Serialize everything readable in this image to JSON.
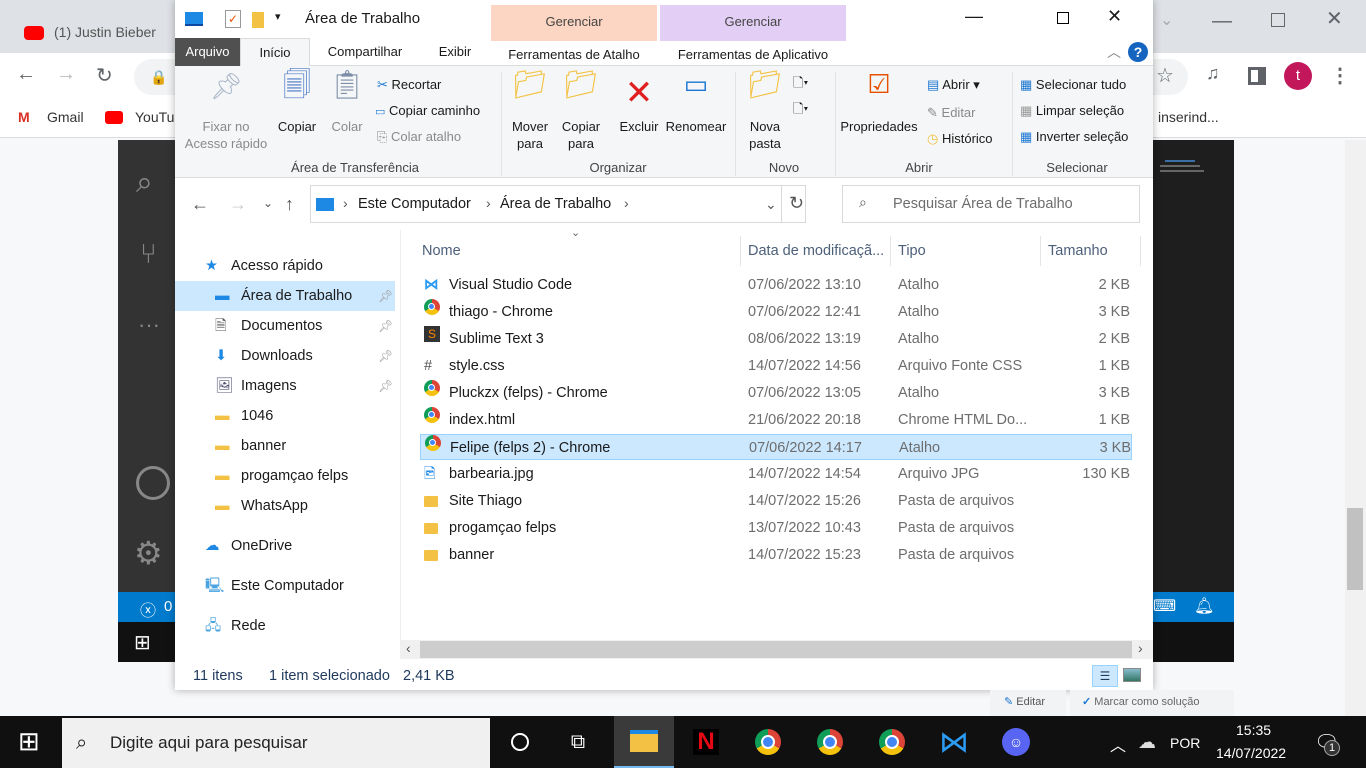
{
  "chrome": {
    "tab_title": "(1) Justin Bieber",
    "bookmarks": [
      "Gmail",
      "YouTube"
    ],
    "bookmark_right": "inserind...",
    "profile_initial": "t",
    "profile_color": "#c2185b"
  },
  "explorer": {
    "title": "Área de Trabalho",
    "tabs": [
      "Arquivo",
      "Início",
      "Compartilhar",
      "Exibir"
    ],
    "context_tabs": [
      {
        "group": "Gerenciar",
        "label": "Ferramentas de Atalho",
        "color": "#fcd6c2"
      },
      {
        "group": "Gerenciar",
        "label": "Ferramentas de Aplicativo",
        "color": "#e3cff5"
      }
    ],
    "ribbon": {
      "pin": "Fixar no Acesso rápido",
      "copy": "Copiar",
      "paste": "Colar",
      "cut": "Recortar",
      "copy_path": "Copiar caminho",
      "paste_shortcut": "Colar atalho",
      "group_clipboard": "Área de Transferência",
      "move_to": "Mover para",
      "copy_to": "Copiar para",
      "delete": "Excluir",
      "rename": "Renomear",
      "group_organize": "Organizar",
      "new_folder": "Nova pasta",
      "group_new": "Novo",
      "properties": "Propriedades",
      "open": "Abrir",
      "edit": "Editar",
      "history": "Histórico",
      "group_open": "Abrir",
      "select_all": "Selecionar tudo",
      "clear_selection": "Limpar seleção",
      "invert_selection": "Inverter seleção",
      "group_select": "Selecionar"
    },
    "breadcrumb": [
      "Este Computador",
      "Área de Trabalho"
    ],
    "search_placeholder": "Pesquisar Área de Trabalho",
    "nav": [
      {
        "label": "Acesso rápido",
        "icon": "star-icon"
      },
      {
        "label": "Área de Trabalho",
        "icon": "desktop-icon",
        "pinned": true,
        "selected": true
      },
      {
        "label": "Documentos",
        "icon": "document-icon",
        "pinned": true
      },
      {
        "label": "Downloads",
        "icon": "download-icon",
        "pinned": true
      },
      {
        "label": "Imagens",
        "icon": "image-icon",
        "pinned": true
      },
      {
        "label": "1046",
        "icon": "folder-icon"
      },
      {
        "label": "banner",
        "icon": "folder-icon"
      },
      {
        "label": "progamçao felps",
        "icon": "folder-icon"
      },
      {
        "label": "WhatsApp",
        "icon": "folder-icon"
      },
      {
        "label": "OneDrive",
        "icon": "cloud-icon"
      },
      {
        "label": "Este Computador",
        "icon": "computer-icon"
      },
      {
        "label": "Rede",
        "icon": "network-icon"
      }
    ],
    "columns": [
      "Nome",
      "Data de modificaçã...",
      "Tipo",
      "Tamanho"
    ],
    "files": [
      {
        "name": "Visual Studio Code",
        "date": "07/06/2022 13:10",
        "type": "Atalho",
        "size": "2 KB",
        "icon": "vscode-icon"
      },
      {
        "name": "thiago - Chrome",
        "date": "07/06/2022 12:41",
        "type": "Atalho",
        "size": "3 KB",
        "icon": "chrome-icon"
      },
      {
        "name": "Sublime Text 3",
        "date": "08/06/2022 13:19",
        "type": "Atalho",
        "size": "2 KB",
        "icon": "sublime-icon"
      },
      {
        "name": "style.css",
        "date": "14/07/2022 14:56",
        "type": "Arquivo Fonte CSS",
        "size": "1 KB",
        "icon": "css-file-icon"
      },
      {
        "name": "Pluckzx (felps) - Chrome",
        "date": "07/06/2022 13:05",
        "type": "Atalho",
        "size": "3 KB",
        "icon": "chrome-icon"
      },
      {
        "name": "index.html",
        "date": "21/06/2022 20:18",
        "type": "Chrome HTML Do...",
        "size": "1 KB",
        "icon": "chrome-icon"
      },
      {
        "name": "Felipe (felps 2) - Chrome",
        "date": "07/06/2022 14:17",
        "type": "Atalho",
        "size": "3 KB",
        "icon": "chrome-icon",
        "selected": true
      },
      {
        "name": "barbearia.jpg",
        "date": "14/07/2022 14:54",
        "type": "Arquivo JPG",
        "size": "130 KB",
        "icon": "image-file-icon"
      },
      {
        "name": "Site Thiago",
        "date": "14/07/2022 15:26",
        "type": "Pasta de arquivos",
        "size": "",
        "icon": "folder-icon"
      },
      {
        "name": "progamçao felps",
        "date": "13/07/2022 10:43",
        "type": "Pasta de arquivos",
        "size": "",
        "icon": "folder-icon"
      },
      {
        "name": "banner",
        "date": "14/07/2022 15:23",
        "type": "Pasta de arquivos",
        "size": "",
        "icon": "folder-icon"
      }
    ],
    "status": {
      "count": "11 itens",
      "selected": "1 item selecionado",
      "size": "2,41 KB"
    }
  },
  "page_buttons": {
    "edit": "Editar",
    "mark_solution": "Marcar como solução"
  },
  "vscode": {
    "status_errors": "0"
  },
  "taskbar": {
    "search_placeholder": "Digite aqui para pesquisar",
    "lang": "POR",
    "time": "15:35",
    "date": "14/07/2022",
    "notif_count": "1"
  }
}
